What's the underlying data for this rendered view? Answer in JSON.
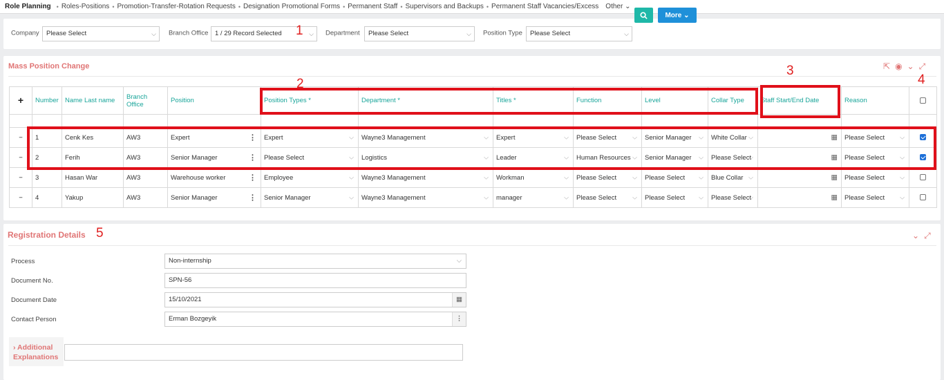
{
  "topnav": {
    "active": "Role Planning",
    "items": [
      "Roles-Positions",
      "Promotion-Transfer-Rotation Requests",
      "Designation Promotional Forms",
      "Permanent Staff",
      "Supervisors and Backups",
      "Permanent Staff Vacancies/Excess"
    ],
    "other": "Other"
  },
  "filters": {
    "company_label": "Company",
    "company_value": "Please Select",
    "branch_label": "Branch Office",
    "branch_value": "1 / 29 Record Selected",
    "department_label": "Department",
    "department_value": "Please Select",
    "position_type_label": "Position Type",
    "position_type_value": "Please Select",
    "more_label": "More"
  },
  "annotations": [
    "1",
    "2",
    "3",
    "4",
    "5"
  ],
  "mass_panel": {
    "title": "Mass Position Change",
    "columns": [
      "+",
      "Number",
      "Name Last name",
      "Branch Office",
      "Position",
      "Position Types *",
      "Department *",
      "Titles *",
      "Function",
      "Level",
      "Collar Type",
      "Staff Start/End Date",
      "Reason"
    ],
    "rows": [
      {
        "number": "1",
        "name": "Cenk Kes",
        "branch": "AW3",
        "position": "Expert",
        "position_type": "Expert",
        "department": "Wayne3 Management",
        "title": "Expert",
        "function": "Please Select",
        "level": "Senior Manager",
        "collar": "White Collar",
        "reason": "Please Select",
        "checked": true
      },
      {
        "number": "2",
        "name": "Ferih",
        "branch": "AW3",
        "position": "Senior Manager",
        "position_type": "Please Select",
        "department": "Logistics",
        "title": "Leader",
        "function": "Human Resources",
        "level": "Senior Manager",
        "collar": "Please Select",
        "reason": "Please Select",
        "checked": true
      },
      {
        "number": "3",
        "name": "Hasan War",
        "branch": "AW3",
        "position": "Warehouse worker",
        "position_type": "Employee",
        "department": "Wayne3 Management",
        "title": "Workman",
        "function": "Please Select",
        "level": "Please Select",
        "collar": "Blue Collar",
        "reason": "Please Select",
        "checked": false
      },
      {
        "number": "4",
        "name": "Yakup",
        "branch": "AW3",
        "position": "Senior Manager",
        "position_type": "Senior Manager",
        "department": "Wayne3 Management",
        "title": "manager",
        "function": "Please Select",
        "level": "Please Select",
        "collar": "Please Select",
        "reason": "Please Select",
        "checked": false
      }
    ]
  },
  "registration": {
    "title": "Registration Details",
    "process_label": "Process",
    "process_value": "Non-internship",
    "docno_label": "Document No.",
    "docno_value": "SPN-56",
    "docdate_label": "Document Date",
    "docdate_value": "15/10/2021",
    "contact_label": "Contact Person",
    "contact_value": "Erman Bozgeyik",
    "explanations_label": "Additional Explanations"
  }
}
